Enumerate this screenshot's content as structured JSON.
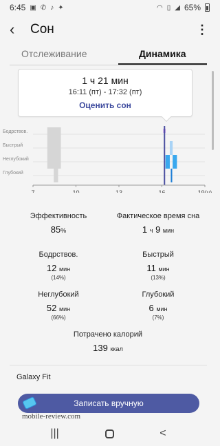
{
  "status_bar": {
    "time": "6:45",
    "battery": "65%",
    "icons": [
      "image-icon",
      "call-icon",
      "tiktok-icon",
      "twitter-icon",
      "wifi-icon",
      "vibrate-icon",
      "signal-icon",
      "battery-icon"
    ]
  },
  "header": {
    "title": "Сон"
  },
  "tabs": [
    {
      "label": "Отслеживание",
      "active": false
    },
    {
      "label": "Динамика",
      "active": true
    }
  ],
  "tooltip": {
    "duration": "1 ч 21 мин",
    "range": "16:11 (пт) - 17:32 (пт)",
    "rate_link": "Оценить сон"
  },
  "chart_data": {
    "type": "timeline",
    "stages": [
      "Бодрствов.",
      "Быстрый",
      "Неглубокий",
      "Глубокий"
    ],
    "x_ticks": [
      "7",
      "10",
      "13",
      "16",
      "19(ч)"
    ],
    "x_range": [
      7,
      19
    ],
    "selected_hour": 16.18,
    "segments": [
      {
        "start": 8,
        "end": 8.95,
        "stage": "Бодрствов.",
        "session": "previous"
      },
      {
        "start": 8,
        "end": 8.95,
        "stage": "Быстрый",
        "session": "previous"
      },
      {
        "start": 8,
        "end": 8.95,
        "stage": "Неглубокий",
        "session": "previous"
      },
      {
        "start": 8.45,
        "end": 8.75,
        "stage": "Глубокий",
        "session": "previous"
      },
      {
        "start": 16.1,
        "end": 16.25,
        "stage": "Бодрствов.",
        "session": "selected"
      },
      {
        "start": 16.25,
        "end": 16.55,
        "stage": "Неглубокий",
        "session": "selected"
      },
      {
        "start": 16.55,
        "end": 16.75,
        "stage": "Быстрый",
        "session": "selected"
      },
      {
        "start": 16.75,
        "end": 17.05,
        "stage": "Неглубокий",
        "session": "selected"
      },
      {
        "start": 16.62,
        "end": 16.72,
        "stage": "Глубокий",
        "session": "selected"
      }
    ],
    "colors": {
      "previous": "#d6d6d6",
      "awake": "#c07cf0",
      "rem": "#a8d3f6",
      "light": "#39a8ee",
      "deep": "#1f7fd6",
      "selected_line": "#4a4fa0"
    }
  },
  "stats": {
    "efficiency": {
      "label": "Эффективность",
      "value": "85",
      "unit": "%"
    },
    "actual_time": {
      "label": "Фактическое время сна",
      "hours": "1",
      "hours_unit": "ч",
      "minutes": "9",
      "minutes_unit": "мин"
    },
    "awake": {
      "label": "Бодрствов.",
      "value": "12",
      "unit": "мин",
      "percent": "(14%)"
    },
    "rem": {
      "label": "Быстрый",
      "value": "11",
      "unit": "мин",
      "percent": "(13%)"
    },
    "light": {
      "label": "Неглубокий",
      "value": "52",
      "unit": "мин",
      "percent": "(66%)"
    },
    "deep": {
      "label": "Глубокий",
      "value": "6",
      "unit": "мин",
      "percent": "(7%)"
    },
    "calories": {
      "label": "Потрачено калорий",
      "value": "139",
      "unit": "ккал"
    }
  },
  "device": {
    "label": "Galaxy Fit"
  },
  "actions": {
    "manual_button": "Записать вручную"
  },
  "watermark": "mobile-review.com",
  "nav": {
    "recents": "|||",
    "home": "○",
    "back": "<"
  }
}
